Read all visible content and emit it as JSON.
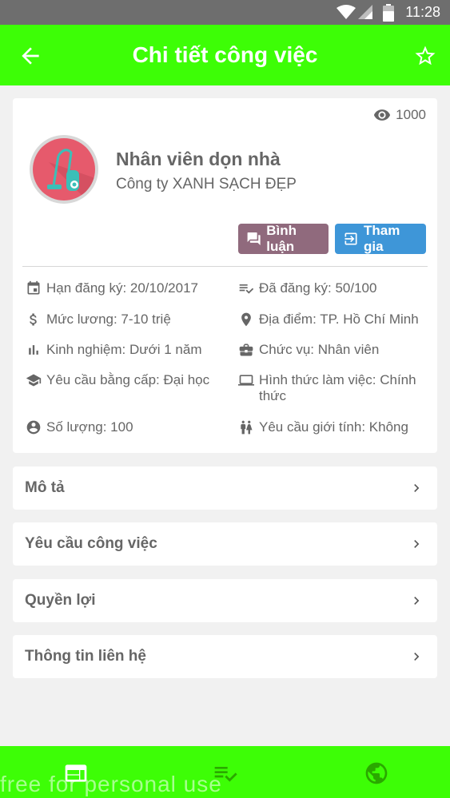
{
  "status_bar": {
    "time": "11:28"
  },
  "app_bar": {
    "title": "Chi tiết công việc"
  },
  "job": {
    "views": "1000",
    "title": "Nhân viên dọn nhà",
    "company": "Công ty XANH SẠCH ĐẸP",
    "comment_button": "Bình luận",
    "join_button": "Tham gia",
    "details": {
      "deadline": "Hạn đăng ký: 20/10/2017",
      "registered": "Đã đăng ký: 50/100",
      "salary": "Mức lương: 7-10 triệ",
      "location": "Địa điểm: TP. Hồ Chí Minh",
      "experience": "Kinh nghiệm: Dưới 1 năm",
      "position": "Chức vụ: Nhân viên",
      "degree": "Yêu cầu bằng cấp: Đại học",
      "work_type": "Hình thức làm việc: Chính thức",
      "quantity": "Số lượng: 100",
      "gender": "Yêu cầu giới tính: Không"
    }
  },
  "sections": [
    {
      "label": "Mô tả"
    },
    {
      "label": "Yêu cầu công việc"
    },
    {
      "label": "Quyền lợi"
    },
    {
      "label": "Thông tin liên hệ"
    }
  ],
  "bottom_nav": {
    "icons": [
      "web-icon",
      "playlist-check-icon",
      "globe-icon"
    ],
    "watermark": "free for personal use"
  },
  "colors": {
    "accent_green": "#3dfe06",
    "comment_button": "#906a7d",
    "join_button": "#3e96d8",
    "avatar_bg": "#e65a6c"
  }
}
